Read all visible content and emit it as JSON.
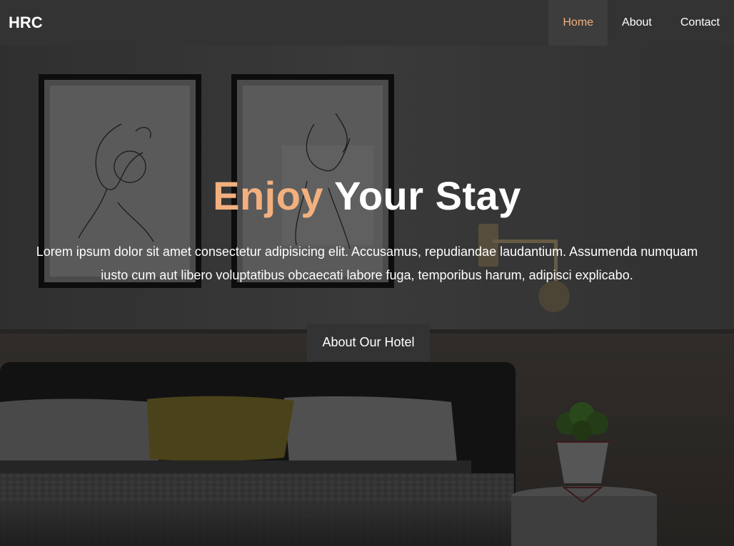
{
  "brand": "HRC",
  "nav": {
    "items": [
      {
        "label": "Home",
        "active": true
      },
      {
        "label": "About",
        "active": false
      },
      {
        "label": "Contact",
        "active": false
      }
    ]
  },
  "hero": {
    "title_accent": "Enjoy",
    "title_rest": " Your Stay",
    "text": "Lorem ipsum dolor sit amet consectetur adipisicing elit. Accusamus, repudiandae laudantium. Assumenda numquam iusto cum aut libero voluptatibus obcaecati labore fuga, temporibus harum, adipisci explicabo.",
    "button_label": "About Our Hotel"
  },
  "colors": {
    "navbar": "#333333",
    "accent": "#f2b07e",
    "button": "#333333"
  }
}
